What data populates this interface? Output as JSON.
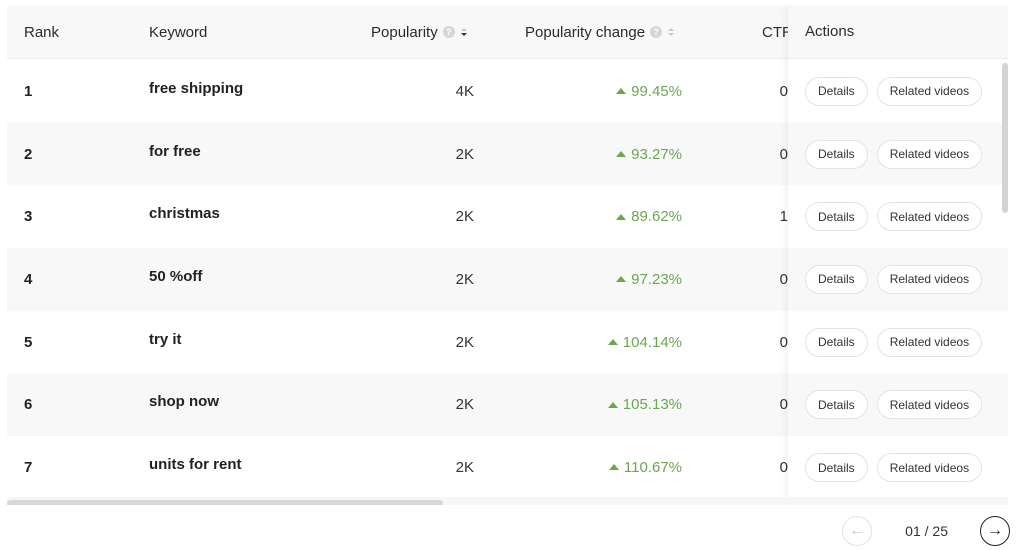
{
  "table": {
    "columns": {
      "rank": "Rank",
      "keyword": "Keyword",
      "popularity": "Popularity",
      "popularity_change": "Popularity change",
      "ctr": "CTR",
      "actions": "Actions"
    },
    "sort": {
      "column": "popularity",
      "direction": "desc"
    },
    "change_color": "#6aa84f",
    "rows": [
      {
        "rank": "1",
        "keyword": "free shipping",
        "popularity": "4K",
        "change": "99.45%",
        "change_dir": "up",
        "ctr": "0"
      },
      {
        "rank": "2",
        "keyword": "for free",
        "popularity": "2K",
        "change": "93.27%",
        "change_dir": "up",
        "ctr": "0"
      },
      {
        "rank": "3",
        "keyword": "christmas",
        "popularity": "2K",
        "change": "89.62%",
        "change_dir": "up",
        "ctr": "1"
      },
      {
        "rank": "4",
        "keyword": "50 %off",
        "popularity": "2K",
        "change": "97.23%",
        "change_dir": "up",
        "ctr": "0"
      },
      {
        "rank": "5",
        "keyword": "try it",
        "popularity": "2K",
        "change": "104.14%",
        "change_dir": "up",
        "ctr": "0"
      },
      {
        "rank": "6",
        "keyword": "shop now",
        "popularity": "2K",
        "change": "105.13%",
        "change_dir": "up",
        "ctr": "0"
      },
      {
        "rank": "7",
        "keyword": "units for rent",
        "popularity": "2K",
        "change": "110.67%",
        "change_dir": "up",
        "ctr": "0"
      }
    ],
    "row_actions": {
      "details": "Details",
      "related_videos": "Related videos"
    }
  },
  "icons": {
    "help": "?",
    "prev": "←",
    "next": "→"
  },
  "pagination": {
    "label": "01 / 25",
    "current": 1,
    "total": 25
  }
}
